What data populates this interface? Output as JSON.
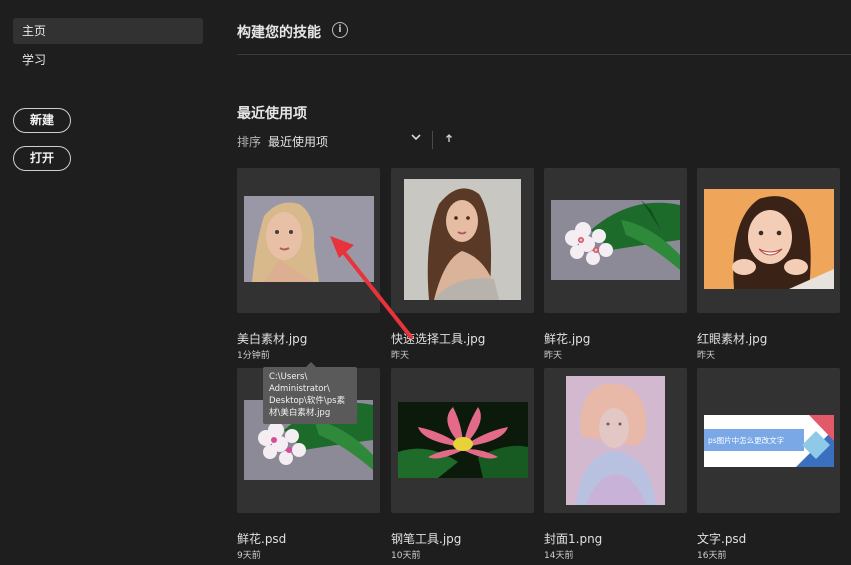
{
  "sidebar": {
    "items": [
      {
        "label": "主页",
        "active": true
      },
      {
        "label": "学习",
        "active": false
      }
    ],
    "new_label": "新建",
    "open_label": "打开"
  },
  "main": {
    "skills_title": "构建您的技能",
    "info_icon": "i",
    "recent_title": "最近使用项",
    "sort_label": "排序",
    "sort_value": "最近使用项"
  },
  "files": [
    {
      "name": "美白素材.jpg",
      "time": "1分钟前",
      "thumb": "portrait-blonde"
    },
    {
      "name": "快速选择工具.jpg",
      "time": "昨天",
      "thumb": "portrait-brunette"
    },
    {
      "name": "鲜花.jpg",
      "time": "昨天",
      "thumb": "plumeria-flowers"
    },
    {
      "name": "红眼素材.jpg",
      "time": "昨天",
      "thumb": "portrait-smiling"
    },
    {
      "name": "鲜花.psd",
      "time": "9天前",
      "thumb": "plumeria-flowers"
    },
    {
      "name": "钢笔工具.jpg",
      "time": "10天前",
      "thumb": "lotus-flower"
    },
    {
      "name": "封面1.png",
      "time": "14天前",
      "thumb": "portrait-pastel"
    },
    {
      "name": "文字.psd",
      "time": "16天前",
      "thumb": "text-banner",
      "banner_text": "ps图片中怎么更改文字"
    }
  ],
  "tooltip": {
    "lines": [
      "C:\\Users\\",
      "Administrator\\",
      "Desktop\\软件\\ps素",
      "材\\美白素材.jpg"
    ]
  },
  "colors": {
    "background": "#1e1e1e",
    "card": "#323232",
    "annotation_arrow": "#e8333a"
  }
}
